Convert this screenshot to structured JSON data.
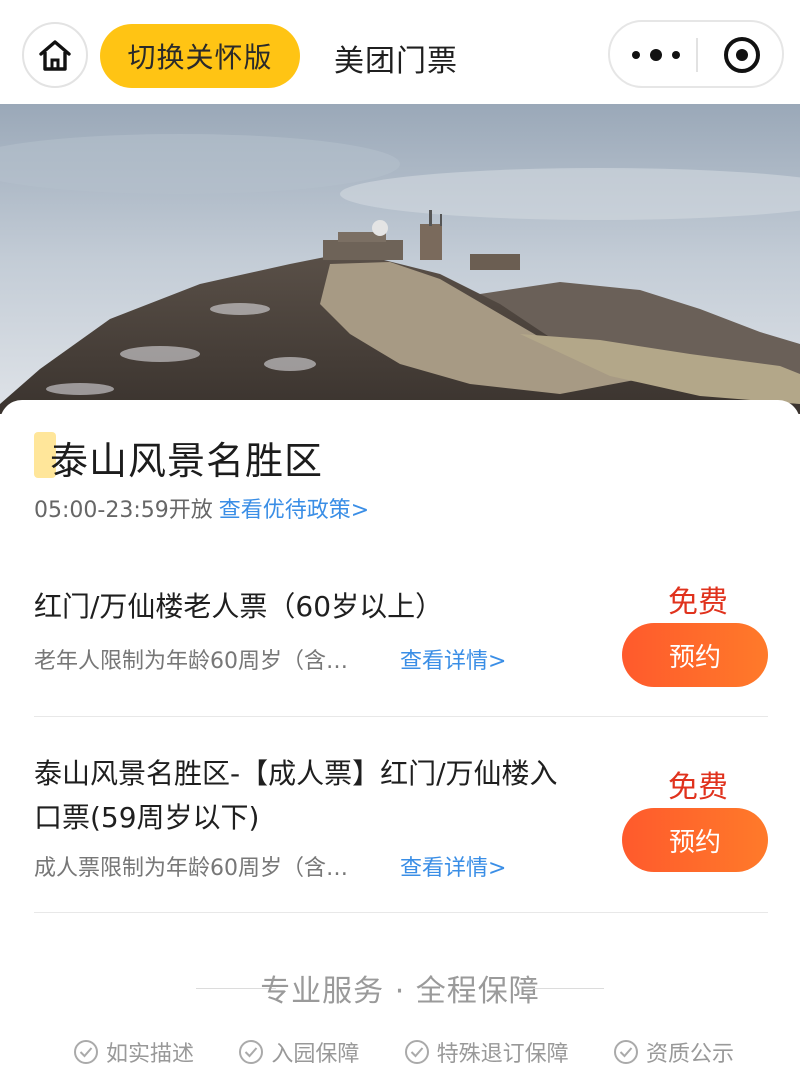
{
  "header": {
    "care_mode_label": "切换关怀版",
    "title": "美团门票"
  },
  "scenic": {
    "name": "泰山风景名胜区",
    "hours": "05:00-23:59开放",
    "policy_link": "查看优待政策>"
  },
  "tickets": [
    {
      "name": "红门/万仙楼老人票（60岁以上）",
      "desc": "老年人限制为年龄60周岁（含…",
      "detail_link": "查看详情>",
      "price": "免费",
      "book_label": "预约"
    },
    {
      "name": "泰山风景名胜区-【成人票】红门/万仙楼入口票(59周岁以下)",
      "desc": "成人票限制为年龄60周岁（含…",
      "detail_link": "查看详情>",
      "price": "免费",
      "book_label": "预约"
    }
  ],
  "service": {
    "title": "专业服务 · 全程保障",
    "items": [
      "如实描述",
      "入园保障",
      "特殊退订保障",
      "资质公示"
    ]
  },
  "colors": {
    "care_button": "#ffc414",
    "price": "#e0321d",
    "book_button": "#ff5a2c",
    "link": "#3a8ee6"
  },
  "icons": [
    "home-icon",
    "more-dots-icon",
    "close-target-icon",
    "check-circle-icon"
  ]
}
